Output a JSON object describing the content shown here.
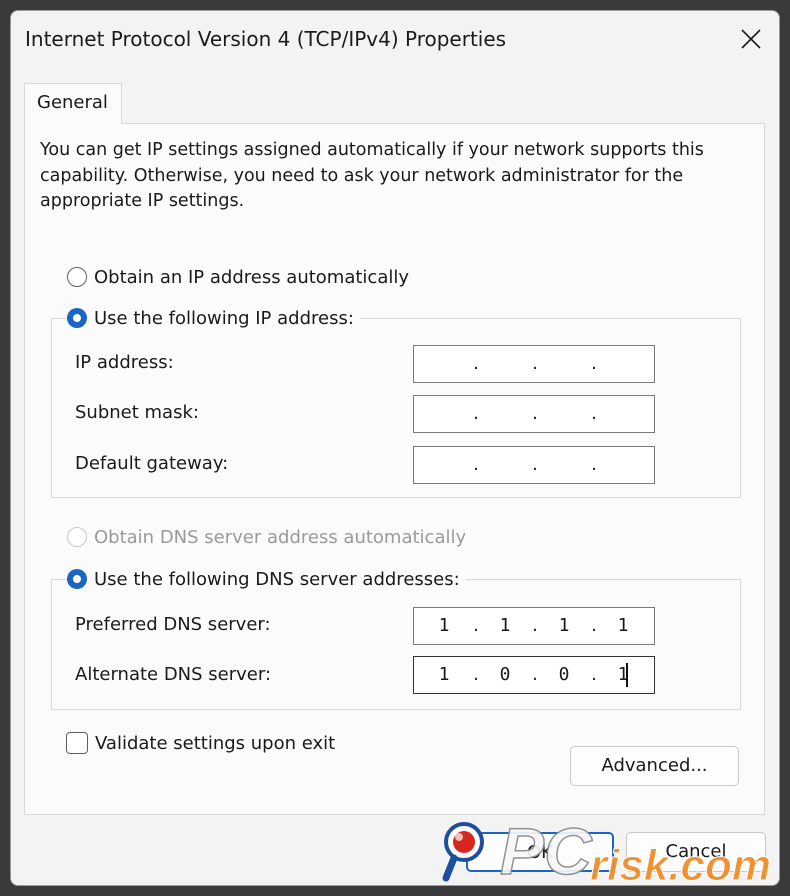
{
  "window": {
    "title": "Internet Protocol Version 4 (TCP/IPv4) Properties"
  },
  "tabs": [
    {
      "label": "General"
    }
  ],
  "description": "You can get IP settings assigned automatically if your network supports this capability. Otherwise, you need to ask your network administrator for the appropriate IP settings.",
  "ip": {
    "auto_label": "Obtain an IP address automatically",
    "manual_label": "Use the following IP address:",
    "selected": "manual",
    "fields": [
      {
        "label": "IP address:",
        "octets": [
          "",
          "",
          "",
          ""
        ]
      },
      {
        "label": "Subnet mask:",
        "octets": [
          "",
          "",
          "",
          ""
        ]
      },
      {
        "label": "Default gateway:",
        "octets": [
          "",
          "",
          "",
          ""
        ]
      }
    ]
  },
  "dns": {
    "auto_label": "Obtain DNS server address automatically",
    "manual_label": "Use the following DNS server addresses:",
    "selected": "manual",
    "fields": [
      {
        "label": "Preferred DNS server:",
        "octets": [
          "1",
          "1",
          "1",
          "1"
        ]
      },
      {
        "label": "Alternate DNS server:",
        "octets": [
          "1",
          "0",
          "0",
          "1"
        ]
      }
    ]
  },
  "validate": {
    "label": "Validate settings upon exit",
    "checked": false
  },
  "buttons": {
    "advanced": "Advanced...",
    "ok": "OK",
    "cancel": "Cancel"
  },
  "watermark": {
    "text_pc": "PC",
    "text_risk": "risk.com"
  },
  "colors": {
    "accent": "#1a66c2",
    "watermark_orange": "#f28c28"
  }
}
